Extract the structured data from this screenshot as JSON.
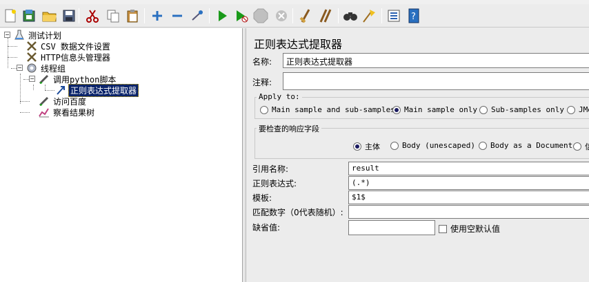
{
  "toolbar": {
    "icons": [
      "new-icon",
      "templates-icon",
      "open-icon",
      "save-icon",
      "cut-icon",
      "copy-icon",
      "paste-icon",
      "expand-icon",
      "collapse-icon",
      "toggle-icon",
      "start-icon",
      "start-no-pause-icon",
      "stop-icon",
      "shutdown-icon",
      "clear-icon",
      "clear-all-icon",
      "search-icon",
      "reset-search-icon",
      "function-helper-icon",
      "help-icon"
    ]
  },
  "tree": {
    "root": "测试计划",
    "csv": "CSV 数据文件设置",
    "http_header": "HTTP信息头管理器",
    "thread_group": "线程组",
    "sampler": "调用python脚本",
    "extractor": "正则表达式提取器",
    "visit": "访问百度",
    "result_tree": "察看结果树"
  },
  "panel": {
    "title": "正则表达式提取器",
    "name_label": "名称:",
    "name_value": "正则表达式提取器",
    "comment_label": "注释:",
    "comment_value": "",
    "apply_to": {
      "title": "Apply to:",
      "options": [
        "Main sample and sub-samples",
        "Main sample only",
        "Sub-samples only",
        "JMe"
      ],
      "selected": 1
    },
    "field_check": {
      "title": "要检查的响应字段",
      "options": [
        "主体",
        "Body (unescaped)",
        "Body as a Document",
        "信"
      ],
      "selected": 0
    },
    "ref_name_label": "引用名称:",
    "ref_name_value": "result",
    "regex_label": "正则表达式:",
    "regex_value": "(.*)",
    "template_label": "模板:",
    "template_value": "$1$",
    "match_no_label": "匹配数字（0代表随机）:",
    "match_no_value": "",
    "default_label": "缺省值:",
    "default_value": "",
    "use_empty_label": "使用空默认值"
  }
}
